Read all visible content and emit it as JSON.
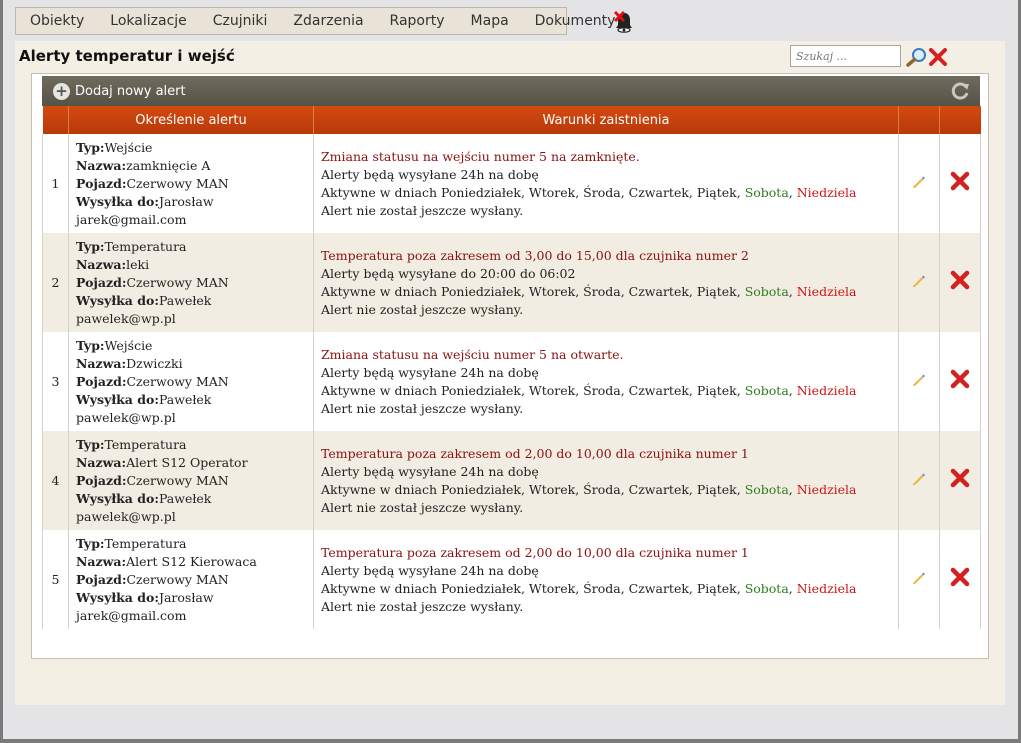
{
  "menu": {
    "items": [
      "Obiekty",
      "Lokalizacje",
      "Czujniki",
      "Zdarzenia",
      "Raporty",
      "Mapa",
      "Dokumenty"
    ]
  },
  "page": {
    "title": "Alerty temperatur i wejść",
    "search_placeholder": "Szukaj ..."
  },
  "toolbar": {
    "add_label": "Dodaj nowy alert"
  },
  "table": {
    "headers": {
      "definition": "Określenie alertu",
      "conditions": "Warunki zaistnienia"
    },
    "labels": {
      "type": "Typ:",
      "name": "Nazwa:",
      "vehicle": "Pojazd:",
      "send_to": "Wysyłka do:"
    },
    "days_prefix": "Aktywne w dniach Poniedziałek, Wtorek, Środa, Czwartek, Piątek,",
    "saturday": "Sobota",
    "sunday": "Niedziela",
    "rows": [
      {
        "num": "1",
        "type": "Wejście",
        "name": "zamknięcie A",
        "vehicle": "Czerwowy MAN",
        "send_to": "Jarosław",
        "email": "jarek@gmail.com",
        "condition": "Zmiana statusu na wejściu numer 5 na zamknięte.",
        "schedule": "Alerty będą wysyłane 24h na dobę",
        "status": "Alert nie został jeszcze wysłany."
      },
      {
        "num": "2",
        "type": "Temperatura",
        "name": "leki",
        "vehicle": "Czerwowy MAN",
        "send_to": "Pawełek",
        "email": "pawelek@wp.pl",
        "condition": "Temperatura poza zakresem od 3,00 do 15,00 dla czujnika numer 2",
        "schedule": "Alerty będą wysyłane do 20:00 do 06:02",
        "status": "Alert nie został jeszcze wysłany."
      },
      {
        "num": "3",
        "type": "Wejście",
        "name": "Dzwiczki",
        "vehicle": "Czerwowy MAN",
        "send_to": "Pawełek",
        "email": "pawelek@wp.pl",
        "condition": "Zmiana statusu na wejściu numer 5 na otwarte.",
        "schedule": "Alerty będą wysyłane 24h na dobę",
        "status": "Alert nie został jeszcze wysłany."
      },
      {
        "num": "4",
        "type": "Temperatura",
        "name": "Alert S12 Operator",
        "vehicle": "Czerwowy MAN",
        "send_to": "Pawełek",
        "email": "pawelek@wp.pl",
        "condition": "Temperatura poza zakresem od 2,00 do 10,00 dla czujnika numer 1",
        "schedule": "Alerty będą wysyłane 24h na dobę",
        "status": "Alert nie został jeszcze wysłany."
      },
      {
        "num": "5",
        "type": "Temperatura",
        "name": "Alert S12 Kierowaca",
        "vehicle": "Czerwowy MAN",
        "send_to": "Jarosław",
        "email": "jarek@gmail.com",
        "condition": "Temperatura poza zakresem od 2,00 do 10,00 dla czujnika numer 1",
        "schedule": "Alerty będą wysyłane 24h na dobę",
        "status": "Alert nie został jeszcze wysłany."
      }
    ]
  },
  "icons": {
    "bell": "bell-muted-icon",
    "search": "magnifier-icon",
    "clear": "red-x-icon",
    "add": "plus-circle-icon",
    "refresh": "refresh-icon",
    "edit": "pencil-icon",
    "delete": "delete-x-icon"
  },
  "colors": {
    "header": "#c24010",
    "toolbar": "#5f5b4f",
    "condition_text": "#8b1010",
    "saturday": "#2e7d1e",
    "sunday": "#d01414",
    "delete": "#d42020"
  }
}
